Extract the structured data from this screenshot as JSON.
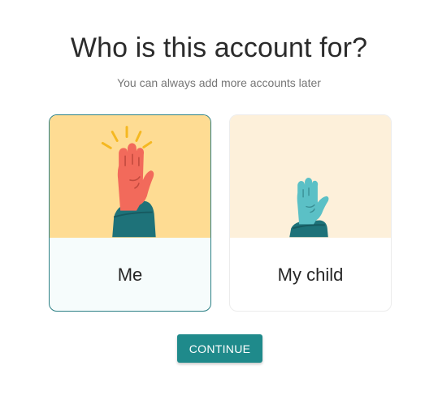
{
  "header": {
    "title": "Who is this account for?",
    "subtitle": "You can always add more accounts later"
  },
  "options": [
    {
      "label": "Me",
      "selected": true,
      "icon": "raised-hand-icon"
    },
    {
      "label": "My child",
      "selected": false,
      "icon": "small-raised-hand-icon"
    }
  ],
  "actions": {
    "continue_label": "CONTINUE"
  },
  "colors": {
    "accent": "#1f8a8b",
    "selected_border": "#2b7f84",
    "me_illustration_bg": "#fedc93",
    "child_illustration_bg": "#fdf0da",
    "adult_hand": "#f26a5b",
    "child_hand": "#5bc0c6",
    "sleeve": "#1e7279",
    "sparkle": "#f5b821"
  }
}
